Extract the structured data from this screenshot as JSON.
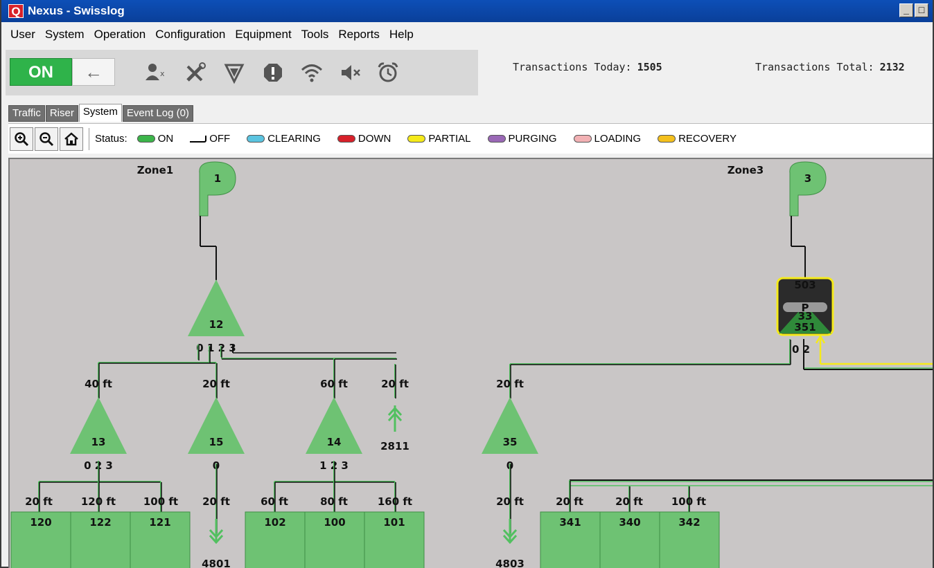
{
  "window": {
    "title": "Nexus - Swisslog",
    "app_icon": "Q",
    "minimize": "_",
    "maximize": "□"
  },
  "menu": [
    "User",
    "System",
    "Operation",
    "Configuration",
    "Equipment",
    "Tools",
    "Reports",
    "Help"
  ],
  "toolbar": {
    "on_label": "ON",
    "back_icon": "←",
    "icons": [
      "user-remove-icon",
      "tools-icon",
      "filter-icon",
      "alert-icon",
      "wifi-icon",
      "mute-icon",
      "alarm-clock-icon"
    ]
  },
  "transactions": {
    "today_label": "Transactions Today:",
    "today_value": "1505",
    "total_label": "Transactions Total:",
    "total_value": "2132"
  },
  "tabs": [
    {
      "label": "Traffic",
      "active": false
    },
    {
      "label": "Riser",
      "active": false
    },
    {
      "label": "System",
      "active": true
    },
    {
      "label": "Event Log (0)",
      "active": false
    }
  ],
  "status": {
    "label": "Status:",
    "legend": [
      {
        "label": "ON",
        "color": "#3cb54a"
      },
      {
        "label": "OFF",
        "color": "#ffffff"
      },
      {
        "label": "CLEARING",
        "color": "#5bc4e0"
      },
      {
        "label": "DOWN",
        "color": "#d7202a"
      },
      {
        "label": "PARTIAL",
        "color": "#f5ea1a"
      },
      {
        "label": "PURGING",
        "color": "#9a68b6"
      },
      {
        "label": "LOADING",
        "color": "#f2b1b4"
      },
      {
        "label": "RECOVERY",
        "color": "#f4c01d"
      }
    ]
  },
  "diagram": {
    "zones": [
      {
        "label": "Zone1",
        "blower": "1"
      },
      {
        "label": "Zone3",
        "blower": "3"
      }
    ],
    "purge_unit": {
      "top": "503",
      "mid": "P",
      "hidden": "33",
      "bottom": "351",
      "ports": "0 2"
    },
    "diverters": [
      {
        "id": "12",
        "ports": "0 1 2 3"
      },
      {
        "id": "13",
        "ports": "0 2 3"
      },
      {
        "id": "15",
        "ports": "0"
      },
      {
        "id": "14",
        "ports": "1 2 3"
      },
      {
        "id": "35",
        "ports": "0"
      }
    ],
    "distances": [
      "40 ft",
      "20 ft",
      "60 ft",
      "20 ft",
      "20 ft",
      "20 ft",
      "120 ft",
      "100 ft",
      "20 ft",
      "60 ft",
      "80 ft",
      "160 ft",
      "20 ft",
      "20 ft",
      "20 ft",
      "100 ft"
    ],
    "stations": [
      "120",
      "122",
      "121",
      "102",
      "100",
      "101",
      "341",
      "340",
      "342"
    ],
    "endpoints": [
      "2811",
      "4801",
      "4803"
    ]
  }
}
